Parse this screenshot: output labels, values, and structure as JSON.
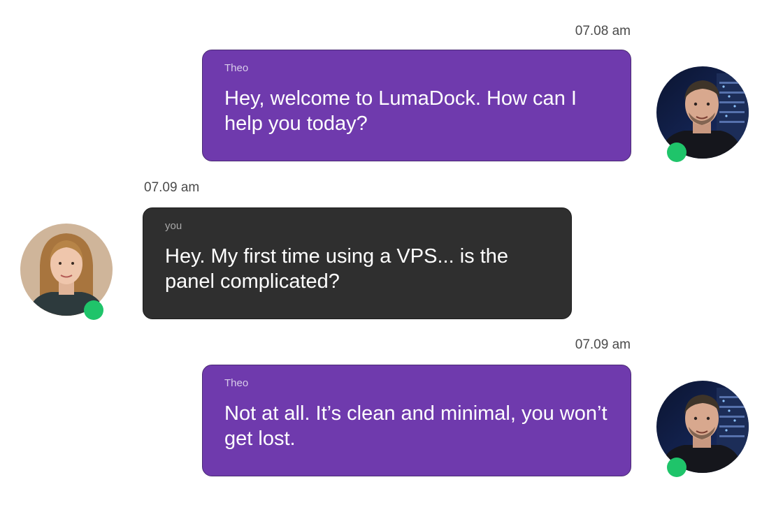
{
  "chat": {
    "messages": [
      {
        "sender": "Theo",
        "role": "agent",
        "time": "07.08 am",
        "text": "Hey, welcome to LumaDock. How can I help you today?",
        "avatar_icon": "agent-avatar",
        "status": "online"
      },
      {
        "sender": "you",
        "role": "user",
        "time": "07.09 am",
        "text": "Hey. My first time using a VPS... is the panel complicated?",
        "avatar_icon": "user-avatar",
        "status": "online"
      },
      {
        "sender": "Theo",
        "role": "agent",
        "time": "07.09 am",
        "text": "Not at all. It’s clean and minimal, you won’t get lost.",
        "avatar_icon": "agent-avatar",
        "status": "online"
      }
    ]
  },
  "colors": {
    "agent_bubble": "#6f3aad",
    "user_bubble": "#2f2f2f",
    "status_online": "#1fc46a"
  }
}
